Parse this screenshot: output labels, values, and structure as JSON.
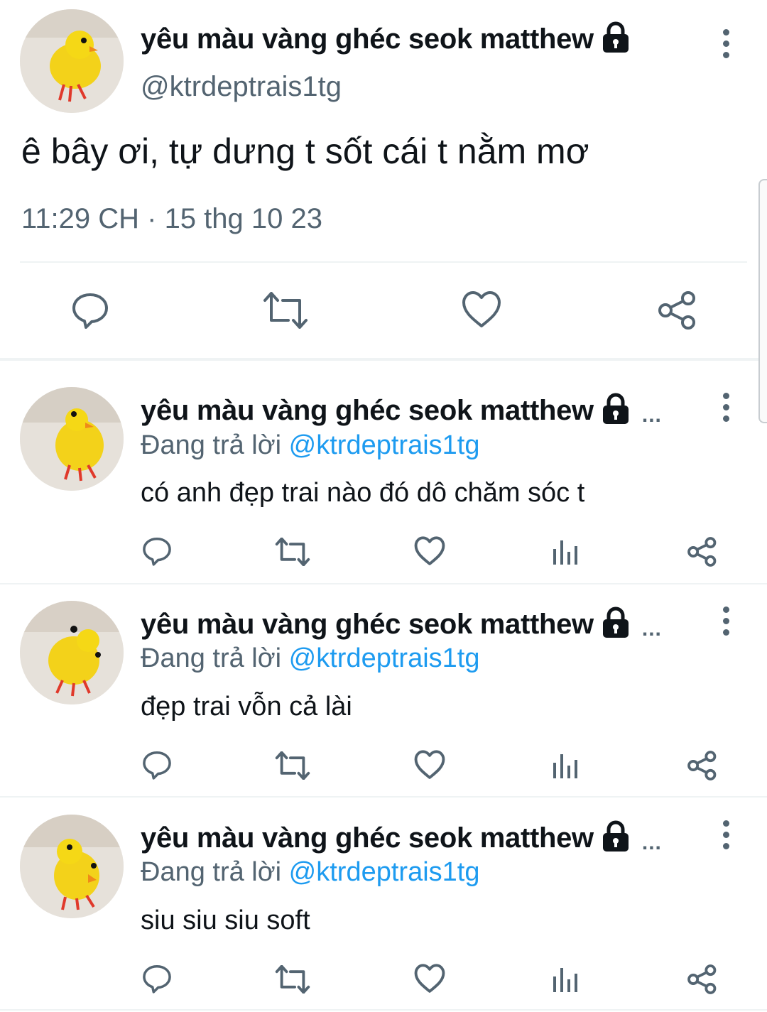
{
  "colors": {
    "text": "#0f1419",
    "secondary": "#536471",
    "mention": "#1d9bf0",
    "divider": "#eff3f4"
  },
  "main_tweet": {
    "display_name": "yêu màu vàng ghéc seok matthew",
    "handle": "@ktrdeptrais1tg",
    "text": "ê bây ơi, tự dưng t sốt cái t nằm mơ",
    "timestamp": "11:29 CH · 15 thg 10 23",
    "actions": [
      "reply-icon",
      "retweet-icon",
      "like-icon",
      "share-icon"
    ]
  },
  "replies": [
    {
      "display_name": "yêu màu vàng ghéc seok matthew",
      "truncation": "...",
      "replying_prefix": "Đang trả lời",
      "replying_to": "@ktrdeptrais1tg",
      "text": "có anh đẹp trai nào đó dô chăm sóc t"
    },
    {
      "display_name": "yêu màu vàng ghéc seok matthew",
      "truncation": "...",
      "replying_prefix": "Đang trả lời",
      "replying_to": "@ktrdeptrais1tg",
      "text": "đẹp trai vỗn cả lài"
    },
    {
      "display_name": "yêu màu vàng ghéc seok matthew",
      "truncation": "...",
      "replying_prefix": "Đang trả lời",
      "replying_to": "@ktrdeptrais1tg",
      "text": "siu siu siu soft"
    }
  ]
}
